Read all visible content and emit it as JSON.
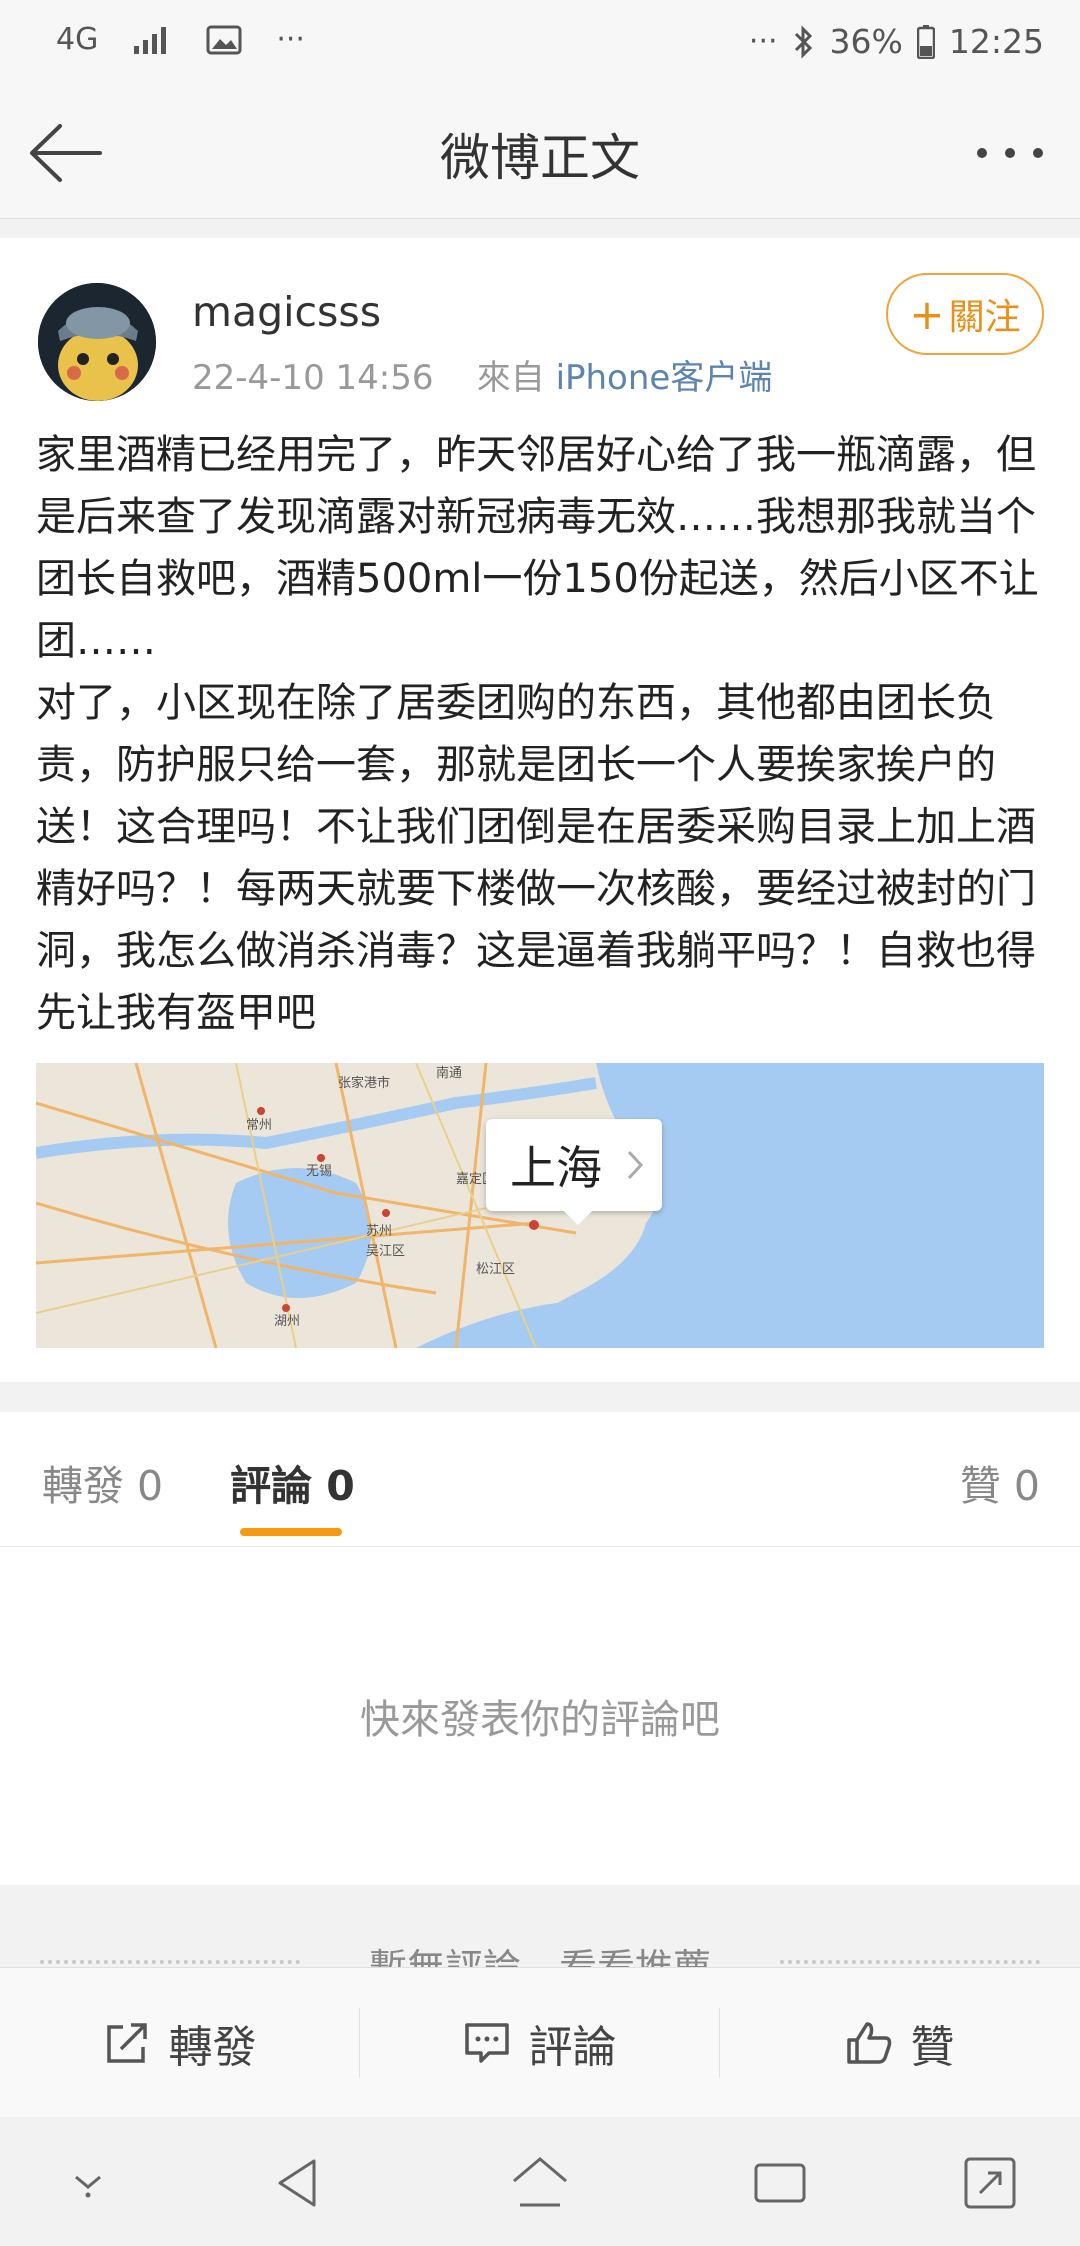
{
  "status_bar": {
    "network": "4G",
    "battery": "36%",
    "time": "12:25",
    "more_left": "···",
    "more_right": "···"
  },
  "nav": {
    "title": "微博正文"
  },
  "post": {
    "username": "magicsss",
    "timestamp": "22-4-10 14:56",
    "source_prefix": "來自",
    "source": "iPhone客户端",
    "follow_label": "關注",
    "paragraphs": [
      "家里酒精已经用完了，昨天邻居好心给了我一瓶滴露，但是后来查了发现滴露对新冠病毒无效……我想那我就当个团长自救吧，酒精500ml一份150份起送，然后小区不让团……",
      "对了，小区现在除了居委团购的东西，其他都由团长负责，防护服只给一套，那就是团长一个人要挨家挨户的送！这合理吗！不让我们团倒是在居委采购目录上加上酒精好吗？！每两天就要下楼做一次核酸，要经过被封的门洞，我怎么做消杀消毒？这是逼着我躺平吗？！自救也得先让我有盔甲吧"
    ],
    "location": "上海"
  },
  "tabs": [
    {
      "label": "轉發 0"
    },
    {
      "label": "評論 0"
    },
    {
      "label": "贊 0"
    }
  ],
  "empty_text": "快來發表你的評論吧",
  "recommend_text": "暫無評論，看看推薦",
  "actions": {
    "repost": "轉發",
    "comment": "評論",
    "like": "贊"
  },
  "map_labels": [
    "南通",
    "常州",
    "无锡",
    "苏州",
    "湖州",
    "上海",
    "张家港市",
    "吴江区",
    "嘉定区",
    "松江区"
  ]
}
